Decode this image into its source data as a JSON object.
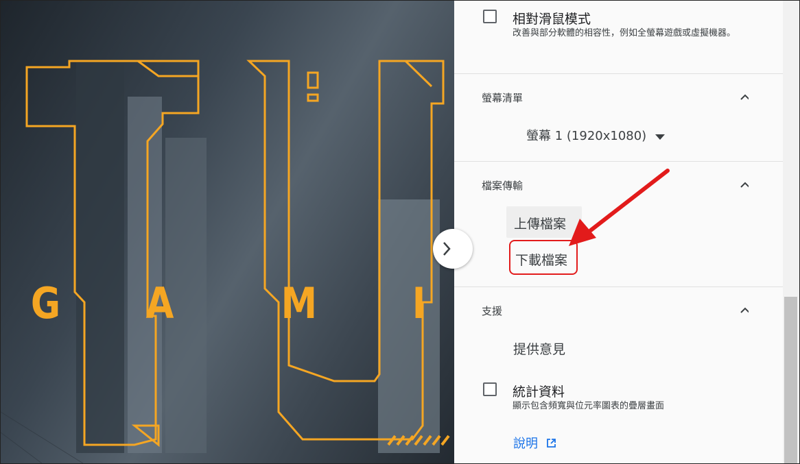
{
  "wallpaper": {
    "letters": [
      "G",
      "A",
      "M",
      "I"
    ],
    "accent_color": "#f5a623"
  },
  "relative_mouse": {
    "title": "相對滑鼠模式",
    "description": "改善與部分軟體的相容性，例如全螢幕遊戲或虛擬機器。",
    "checked": false
  },
  "screen_list": {
    "title": "螢幕清單",
    "selected_screen": "螢幕 1 (1920x1080)"
  },
  "file_transfer": {
    "title": "檔案傳輸",
    "upload_label": "上傳檔案",
    "download_label": "下載檔案"
  },
  "support": {
    "title": "支援",
    "feedback_label": "提供意見"
  },
  "stats": {
    "title": "統計資料",
    "description": "顯示包含頻寬與位元率圖表的疊層畫面",
    "checked": false
  },
  "help": {
    "label": "說明",
    "icon": "open-in-new-icon"
  },
  "annotation": {
    "color": "#e21b1b"
  }
}
